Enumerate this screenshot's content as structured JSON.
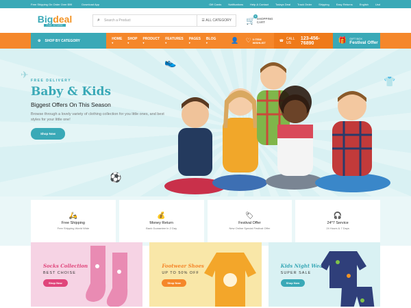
{
  "topbar": {
    "shipping_note": "Free Shipping On Order Over $99",
    "download_app": "Download App",
    "links": [
      "Gift Cards",
      "Notifications",
      "Help & Contact",
      "Todays Deal",
      "Track Order",
      "Shipping",
      "Easy Returns",
      "English",
      "Usd"
    ]
  },
  "header": {
    "logo_main_a": "Big",
    "logo_main_b": "deal",
    "logo_sub": "THE STORE",
    "search_placeholder": "Search a Product",
    "category_select": "ALL CATEGORY",
    "cart_count": "0",
    "cart_label_1": "SHOPPING",
    "cart_label_2": "CART"
  },
  "nav": {
    "shop_by_category": "SHOP BY CATEGORY",
    "menu": [
      "HOME",
      "SHOP",
      "PRODUCT",
      "FEATURES",
      "PAGES",
      "BLOG"
    ],
    "wishlist_count": "0 ITEM",
    "wishlist_label": "WISHLIST",
    "call_label": "CALL US",
    "call_number": "123-456-76890",
    "gift_kicker": "GIFT BOX",
    "gift_title": "Festival Offer"
  },
  "hero": {
    "kicker": "FREE DELIVERY",
    "title": "Baby & Kids",
    "subtitle": "Biggest Offers On This Season",
    "body": "Browse through a lovely variety of clothing collection for you little ones, and best styles for your little one!",
    "button": "Shop Now"
  },
  "features": [
    {
      "icon": "delivery-scooter-icon",
      "title": "Free Shipping",
      "sub": "Free Shipping World Wide"
    },
    {
      "icon": "money-bag-icon",
      "title": "Money Return",
      "sub": "Back Guarantee In 2 Day"
    },
    {
      "icon": "sale-tag-icon",
      "title": "Festival Offer",
      "sub": "New Online Special Festival Offer"
    },
    {
      "icon": "support-agent-icon",
      "title": "24*7 Service",
      "sub": "24 Hours & 7 Days"
    }
  ],
  "banners": [
    {
      "title": "Socks Collection",
      "sub": "BEST CHOISE",
      "button": "Shop Now"
    },
    {
      "title": "Footwear Shoes",
      "sub": "UP TO 50% OFF",
      "button": "Shop Now"
    },
    {
      "title": "Kids Night Wear",
      "sub": "SUPER SALE",
      "button": "Shop Now"
    }
  ],
  "colors": {
    "teal": "#3aa9b7",
    "orange": "#f5872a",
    "pink": "#e0457b"
  }
}
